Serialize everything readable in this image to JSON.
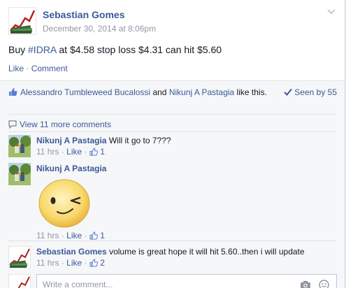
{
  "post": {
    "author": "Sebastian Gomes",
    "date": "December 30, 2014 at 8:06pm",
    "text_prefix": "Buy ",
    "hashtag": "#IDRA",
    "text_suffix": " at $4.58 stop loss $4.31 can hit $5.60",
    "actions": {
      "like": "Like",
      "separator": "·",
      "comment": "Comment"
    }
  },
  "likes": {
    "user1": "Alessandro Tumbleweed Bucalossi",
    "joiner": " and ",
    "user2": "Nikunj A Pastagia",
    "suffix": " like this.",
    "seen_by": "Seen by 55"
  },
  "view_more": "View 11 more comments",
  "comments": [
    {
      "author": "Nikunj A Pastagia",
      "text": "Will it go to 7???",
      "time": "11 hrs",
      "sep": "·",
      "like": "Like",
      "likes": "1"
    },
    {
      "author": "Nikunj A Pastagia",
      "text": "",
      "time": "11 hrs",
      "sep": "·",
      "like": "Like",
      "likes": "1",
      "sticker": "wink-sticker"
    },
    {
      "author": "Sebastian Gomes",
      "text": "volume is great hope it will hit 5.60..then i will update",
      "time": "11 hrs",
      "sep": "·",
      "like": "Like",
      "likes": "2"
    }
  ],
  "composer": {
    "placeholder": "Write a comment..."
  },
  "colors": {
    "link": "#3b5998",
    "meta": "#9197a3",
    "ufi_bg": "#f6f7f9"
  }
}
